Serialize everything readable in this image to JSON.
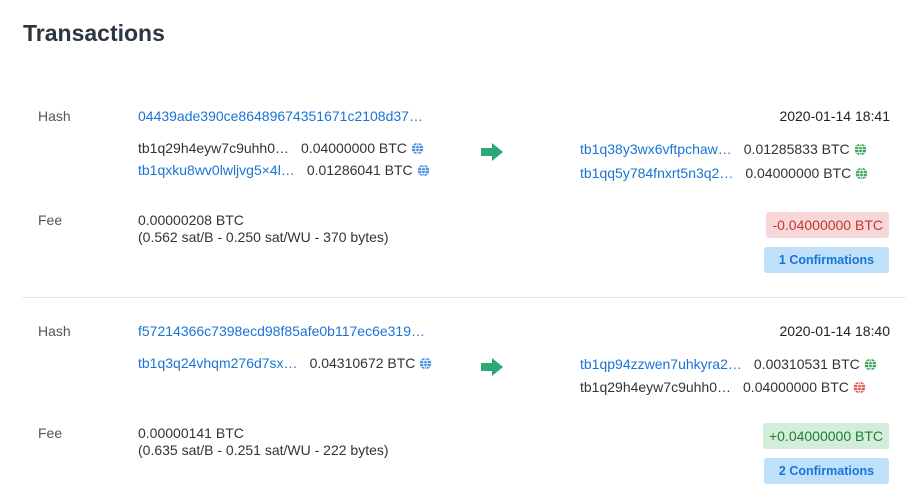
{
  "page_title": "Transactions",
  "labels": {
    "hash": "Hash",
    "fee": "Fee"
  },
  "colors": {
    "link": "#1a74d6",
    "arrow": "#2aa876",
    "globe_blue": "#4a8fe0",
    "globe_green": "#3aa55a",
    "globe_red": "#e05a4a"
  },
  "transactions": [
    {
      "hash": "04439ade390ce86489674351671c2108d37…",
      "time": "2020-01-14 18:41",
      "inputs": [
        {
          "address": "tb1q29h4eyw7c9uhh0…",
          "amount": "0.04000000 BTC",
          "globe": "globe-blue-icon"
        },
        {
          "address": "tb1qxku8wv0lwljvg5×4l…",
          "amount": "0.01286041 BTC",
          "globe": "globe-blue-icon"
        }
      ],
      "outputs": [
        {
          "address": "tb1q38y3wx6vftpchaw…",
          "amount": "0.01285833 BTC",
          "globe": "globe-green-icon"
        },
        {
          "address": "tb1qq5y784fnxrt5n3q2…",
          "amount": "0.04000000 BTC",
          "globe": "globe-green-icon"
        }
      ],
      "fee": "0.00000208 BTC",
      "fee_detail": "(0.562 sat/B - 0.250 sat/WU - 370 bytes)",
      "net_amount": "-0.04000000 BTC",
      "confirmations": "1 Confirmations"
    },
    {
      "hash": "f57214366c7398ecd98f85afe0b117ec6e319…",
      "time": "2020-01-14 18:40",
      "inputs": [
        {
          "address": "tb1q3q24vhqm276d7sx…",
          "amount": "0.04310672 BTC",
          "globe": "globe-blue-icon"
        }
      ],
      "outputs": [
        {
          "address": "tb1qp94zzwen7uhkyra2…",
          "amount": "0.00310531 BTC",
          "globe": "globe-green-icon"
        },
        {
          "address": "tb1q29h4eyw7c9uhh0…",
          "amount": "0.04000000 BTC",
          "globe": "globe-red-icon"
        }
      ],
      "fee": "0.00000141 BTC",
      "fee_detail": "(0.635 sat/B - 0.251 sat/WU - 222 bytes)",
      "net_amount": "+0.04000000 BTC",
      "confirmations": "2 Confirmations"
    }
  ]
}
